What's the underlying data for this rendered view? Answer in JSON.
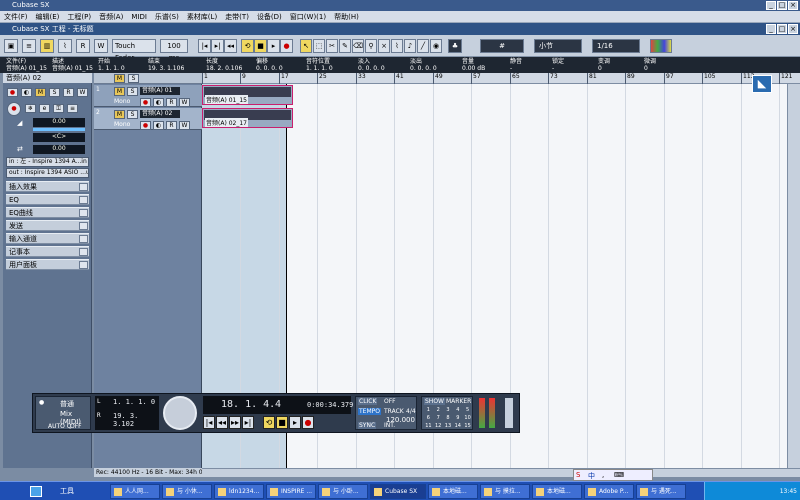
{
  "app": {
    "title": "Cubase SX",
    "window_controls": [
      "_",
      "□",
      "×"
    ]
  },
  "menu": [
    "文件(F)",
    "编辑(E)",
    "工程(P)",
    "音频(A)",
    "MIDI",
    "乐谱(S)",
    "素材库(L)",
    "走带(T)",
    "设备(D)",
    "窗口(W)(1)",
    "帮助(H)"
  ],
  "project": {
    "title": "Cubase SX 工程 - 无标题"
  },
  "toolbar": {
    "automation_mode": "Touch Fader",
    "preroll": "100 ms",
    "snap_grid": "小节",
    "quantize": "1/16"
  },
  "infoline": [
    {
      "label": "文件(F)",
      "value": "音频(A) 01_15"
    },
    {
      "label": "描述",
      "value": "音频(A) 01_15"
    },
    {
      "label": "开始",
      "value": "1. 1. 1. 0"
    },
    {
      "label": "结束",
      "value": "19. 3. 1.106"
    },
    {
      "label": "长度",
      "value": "18. 2. 0.106"
    },
    {
      "label": "偏移",
      "value": "0. 0. 0. 0"
    },
    {
      "label": "音符位置",
      "value": "1. 1. 1. 0"
    },
    {
      "label": "淡入",
      "value": "0. 0. 0. 0"
    },
    {
      "label": "淡出",
      "value": "0. 0. 0. 0"
    },
    {
      "label": "音量",
      "value": "0.00 dB"
    },
    {
      "label": "静音",
      "value": "-"
    },
    {
      "label": "锁定",
      "value": "-"
    },
    {
      "label": "变调",
      "value": "0"
    },
    {
      "label": "微调",
      "value": "0"
    }
  ],
  "inspector": {
    "track_name": "音频(A) 02",
    "volume": "0.00",
    "pan": "<C>",
    "delay": "0.00",
    "input": "in : 左 - Inspire 1394 A...in",
    "output": "out : Inspire 1394 ASIO ...ut",
    "sections": [
      "插入效果",
      "EQ",
      "EQ曲线",
      "发送",
      "输入通道",
      "记事本",
      "用户面板"
    ]
  },
  "tracks": [
    {
      "num": "1",
      "name": "音频(A) 01",
      "mono": "Mono",
      "event": "音频(A) 01_15"
    },
    {
      "num": "2",
      "name": "音频(A) 02",
      "mono": "Mono",
      "event": "音频(A) 02_17"
    }
  ],
  "ruler": [
    "1",
    "9",
    "17",
    "25",
    "33",
    "41",
    "49",
    "57",
    "65",
    "73",
    "81",
    "89",
    "97",
    "105",
    "113",
    "121"
  ],
  "transport": {
    "mode": "普通",
    "mix": "Mix (MIDI)",
    "auto_label": "AUTO Q",
    "auto_value": "OFF",
    "left_locator": "1. 1. 1. 0",
    "right_locator": "19. 3. 3.102",
    "position": "18. 1. 4.",
    "position_ticks": "4",
    "time": "0:00:34.379",
    "click": "CLICK",
    "click_state": "OFF",
    "tempo": "TEMPO",
    "track_label": "TRACK",
    "signature": "4/4",
    "bpm": "120.000",
    "sync": "SYNC",
    "sync_state": "INT.",
    "show": "SHOW",
    "marker": "MARKER",
    "marker_grid": [
      "1",
      "2",
      "3",
      "4",
      "5",
      "6",
      "7",
      "8",
      "9",
      "10",
      "11",
      "12",
      "13",
      "14",
      "15"
    ]
  },
  "status": {
    "text": "Rec: 44100 Hz - 16 Bit - Max: 34h 03m"
  },
  "taskbar": {
    "start": "工具",
    "items": [
      "人人网...",
      "与 小休...",
      "ldn1234...",
      "INSPIRE ...",
      "与 小卧...",
      "Cubase SX",
      "本地磁...",
      "与 摸拉...",
      "本地磁...",
      "Adobe P...",
      "与 遇死..."
    ],
    "clock": "13:45"
  },
  "colors": {
    "accent": "#c91f6d",
    "titlebar": "#3a5a8c",
    "taskbar": "#1f4fb4"
  }
}
